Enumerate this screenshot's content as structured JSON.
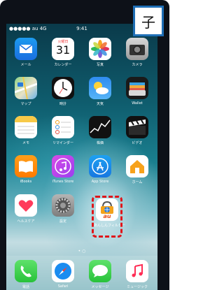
{
  "tag": "子",
  "status": {
    "carrier": "●●●●● au 4G",
    "time": "9:41"
  },
  "calendar": {
    "weekday": "火曜日",
    "day": "31"
  },
  "apps": [
    {
      "label": "メール"
    },
    {
      "label": "カレンダー"
    },
    {
      "label": "写真"
    },
    {
      "label": "カメラ"
    },
    {
      "label": "マップ"
    },
    {
      "label": "時計"
    },
    {
      "label": "天気"
    },
    {
      "label": "Wallet"
    },
    {
      "label": "メモ"
    },
    {
      "label": "リマインダー"
    },
    {
      "label": "株価"
    },
    {
      "label": "ビデオ"
    },
    {
      "label": "iBooks"
    },
    {
      "label": "iTunes Store"
    },
    {
      "label": "App Store"
    },
    {
      "label": "ホーム"
    },
    {
      "label": "ヘルスケア"
    },
    {
      "label": "設定"
    },
    {
      "label": "あんしんフィルター"
    }
  ],
  "au_logo": "au",
  "dock": [
    {
      "label": "電話"
    },
    {
      "label": "Safari"
    },
    {
      "label": "メッセージ"
    },
    {
      "label": "ミュージック"
    }
  ],
  "page_dots": "• ○"
}
